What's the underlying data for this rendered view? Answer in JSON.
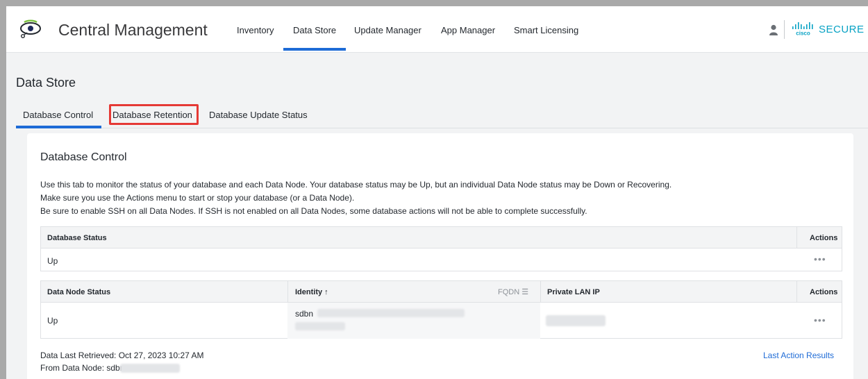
{
  "header": {
    "app_title": "Central Management",
    "nav": [
      "Inventory",
      "Data Store",
      "Update Manager",
      "App Manager",
      "Smart Licensing"
    ],
    "active_nav": "Data Store",
    "brand_text": "SECURE",
    "cisco_text": "cisco"
  },
  "page": {
    "title": "Data Store",
    "tabs": [
      "Database Control",
      "Database Retention",
      "Database Update Status"
    ],
    "active_tab": "Database Control",
    "highlighted_tab": "Database Retention"
  },
  "card": {
    "title": "Database Control",
    "description": [
      "Use this tab to monitor the status of your database and each Data Node. Your database status may be Up, but an individual Data Node status may be Down or Recovering.",
      "Make sure you use the Actions menu to start or stop your database (or a Data Node).",
      "Be sure to enable SSH on all Data Nodes. If SSH is not enabled on all Data Nodes, some database actions will not be able to complete successfully."
    ]
  },
  "database_table": {
    "headers": [
      "Database Status",
      "Actions"
    ],
    "row": {
      "status": "Up",
      "actions": "•••"
    }
  },
  "node_table": {
    "headers": [
      "Data Node Status",
      "Identity ↑",
      "FQDN ☰",
      "Private LAN IP",
      "Actions"
    ],
    "row": {
      "status": "Up",
      "identity": "sdbn",
      "actions": "•••"
    }
  },
  "footer": {
    "retrieved": "Data Last Retrieved: Oct 27, 2023 10:27 AM",
    "from_node": "From Data Node: sdbn",
    "last_action_link": "Last Action Results"
  },
  "colors": {
    "accent": "#1e6bd6",
    "brand": "#07a2c4",
    "highlight_box": "#e53935"
  }
}
